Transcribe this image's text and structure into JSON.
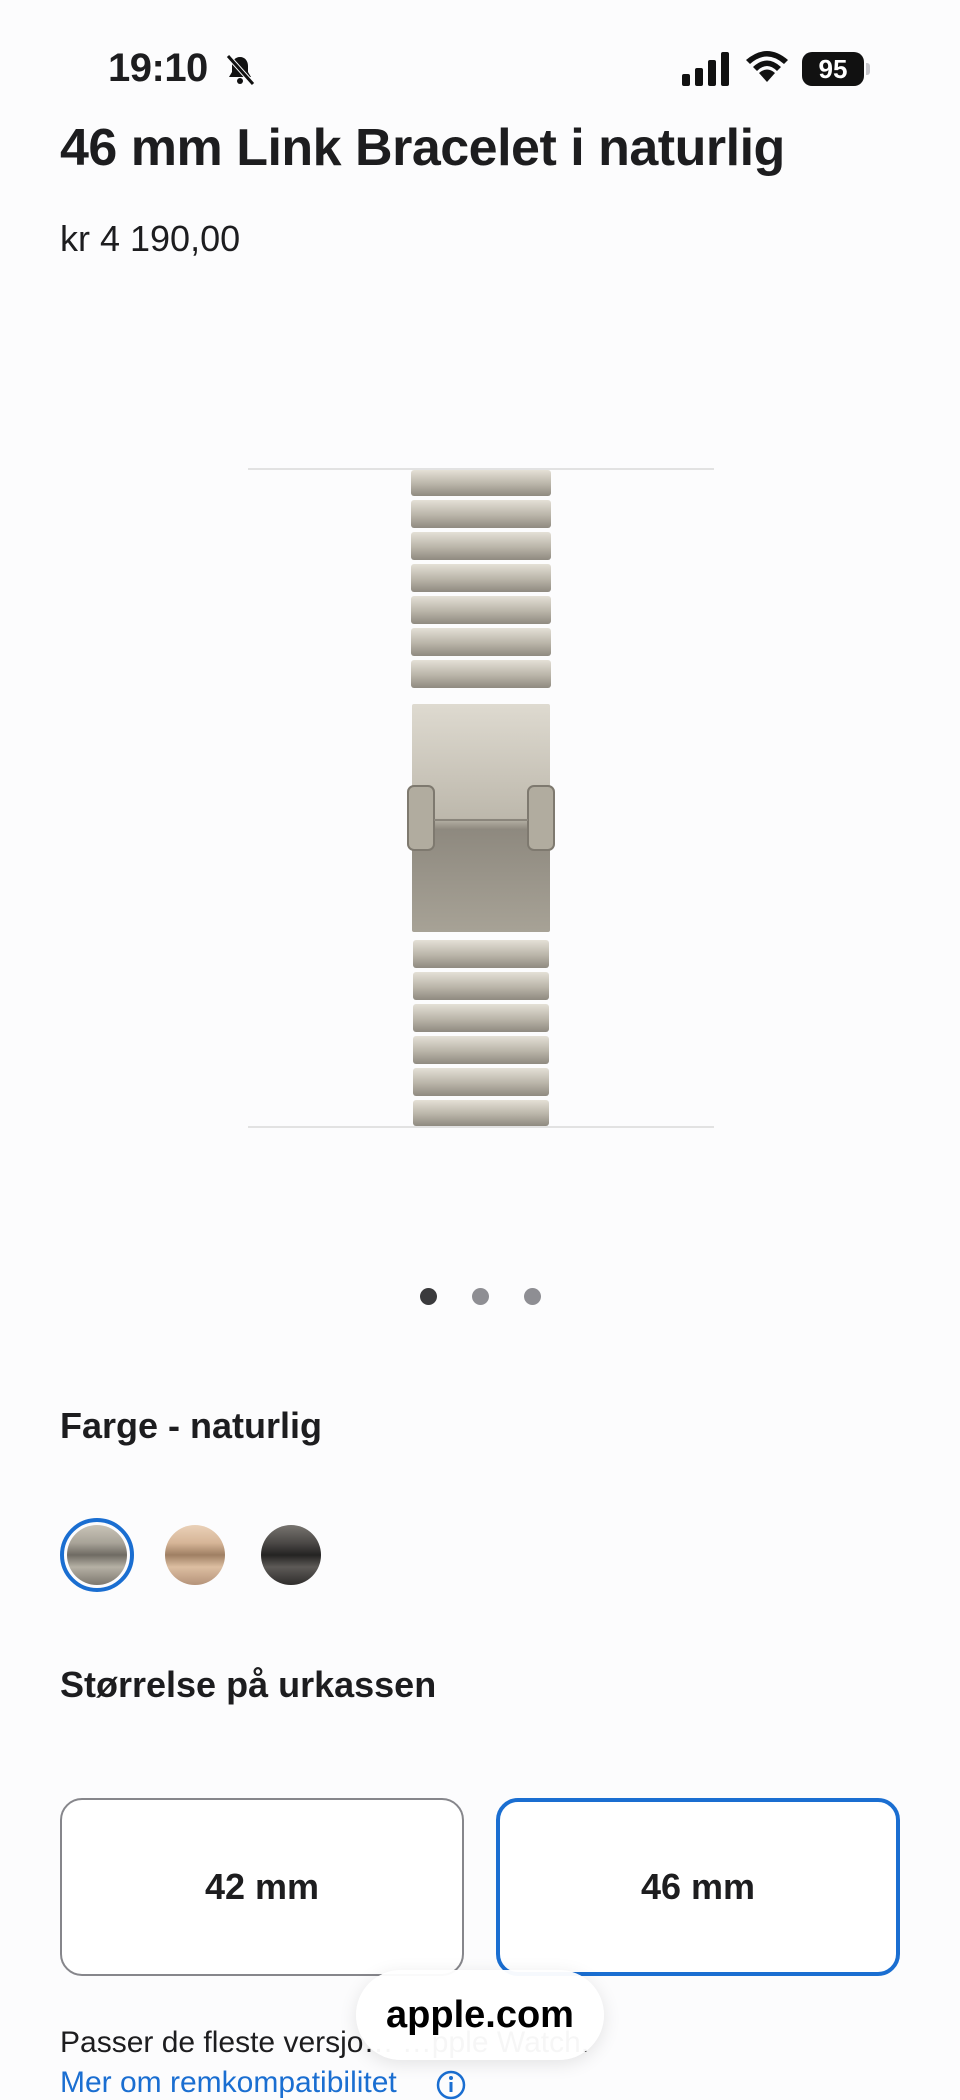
{
  "status_bar": {
    "time": "19:10",
    "battery": "95",
    "icons": [
      "bell-slash-icon",
      "cellular-signal-icon",
      "wifi-icon",
      "battery-icon"
    ]
  },
  "product": {
    "title": "46 mm Link Bracelet i naturlig",
    "price": "kr 4 190,00"
  },
  "gallery": {
    "page_count": 3,
    "active_page": 1
  },
  "color": {
    "label": "Farge - naturlig",
    "swatches": [
      {
        "name": "naturlig",
        "hex": "#8e8a80",
        "selected": true
      },
      {
        "name": "gull",
        "hex": "#c8a585",
        "selected": false
      },
      {
        "name": "skifergrå",
        "hex": "#3f3d3c",
        "selected": false
      }
    ]
  },
  "size": {
    "label": "Størrelse på urkassen",
    "options": [
      {
        "label": "42 mm",
        "selected": false
      },
      {
        "label": "46 mm",
        "selected": true
      }
    ]
  },
  "compatibility": {
    "text": "Passer de fleste versjo… …pple Watch.",
    "link": "Mer om remkompatibilitet"
  },
  "browser": {
    "url": "apple.com"
  },
  "colors": {
    "accent": "#1a6ed1",
    "text": "#1d1d1f",
    "background": "#fcfcfd"
  }
}
